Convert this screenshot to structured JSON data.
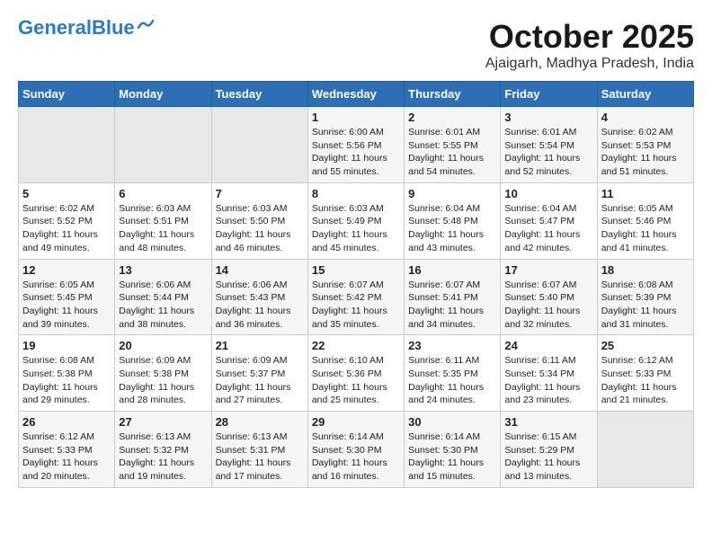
{
  "header": {
    "logo_general": "General",
    "logo_blue": "Blue",
    "month_title": "October 2025",
    "location": "Ajaigarh, Madhya Pradesh, India"
  },
  "weekdays": [
    "Sunday",
    "Monday",
    "Tuesday",
    "Wednesday",
    "Thursday",
    "Friday",
    "Saturday"
  ],
  "weeks": [
    [
      {
        "day": "",
        "empty": true
      },
      {
        "day": "",
        "empty": true
      },
      {
        "day": "",
        "empty": true
      },
      {
        "day": "1",
        "sunrise": "Sunrise: 6:00 AM",
        "sunset": "Sunset: 5:56 PM",
        "daylight": "Daylight: 11 hours and 55 minutes."
      },
      {
        "day": "2",
        "sunrise": "Sunrise: 6:01 AM",
        "sunset": "Sunset: 5:55 PM",
        "daylight": "Daylight: 11 hours and 54 minutes."
      },
      {
        "day": "3",
        "sunrise": "Sunrise: 6:01 AM",
        "sunset": "Sunset: 5:54 PM",
        "daylight": "Daylight: 11 hours and 52 minutes."
      },
      {
        "day": "4",
        "sunrise": "Sunrise: 6:02 AM",
        "sunset": "Sunset: 5:53 PM",
        "daylight": "Daylight: 11 hours and 51 minutes."
      }
    ],
    [
      {
        "day": "5",
        "sunrise": "Sunrise: 6:02 AM",
        "sunset": "Sunset: 5:52 PM",
        "daylight": "Daylight: 11 hours and 49 minutes."
      },
      {
        "day": "6",
        "sunrise": "Sunrise: 6:03 AM",
        "sunset": "Sunset: 5:51 PM",
        "daylight": "Daylight: 11 hours and 48 minutes."
      },
      {
        "day": "7",
        "sunrise": "Sunrise: 6:03 AM",
        "sunset": "Sunset: 5:50 PM",
        "daylight": "Daylight: 11 hours and 46 minutes."
      },
      {
        "day": "8",
        "sunrise": "Sunrise: 6:03 AM",
        "sunset": "Sunset: 5:49 PM",
        "daylight": "Daylight: 11 hours and 45 minutes."
      },
      {
        "day": "9",
        "sunrise": "Sunrise: 6:04 AM",
        "sunset": "Sunset: 5:48 PM",
        "daylight": "Daylight: 11 hours and 43 minutes."
      },
      {
        "day": "10",
        "sunrise": "Sunrise: 6:04 AM",
        "sunset": "Sunset: 5:47 PM",
        "daylight": "Daylight: 11 hours and 42 minutes."
      },
      {
        "day": "11",
        "sunrise": "Sunrise: 6:05 AM",
        "sunset": "Sunset: 5:46 PM",
        "daylight": "Daylight: 11 hours and 41 minutes."
      }
    ],
    [
      {
        "day": "12",
        "sunrise": "Sunrise: 6:05 AM",
        "sunset": "Sunset: 5:45 PM",
        "daylight": "Daylight: 11 hours and 39 minutes."
      },
      {
        "day": "13",
        "sunrise": "Sunrise: 6:06 AM",
        "sunset": "Sunset: 5:44 PM",
        "daylight": "Daylight: 11 hours and 38 minutes."
      },
      {
        "day": "14",
        "sunrise": "Sunrise: 6:06 AM",
        "sunset": "Sunset: 5:43 PM",
        "daylight": "Daylight: 11 hours and 36 minutes."
      },
      {
        "day": "15",
        "sunrise": "Sunrise: 6:07 AM",
        "sunset": "Sunset: 5:42 PM",
        "daylight": "Daylight: 11 hours and 35 minutes."
      },
      {
        "day": "16",
        "sunrise": "Sunrise: 6:07 AM",
        "sunset": "Sunset: 5:41 PM",
        "daylight": "Daylight: 11 hours and 34 minutes."
      },
      {
        "day": "17",
        "sunrise": "Sunrise: 6:07 AM",
        "sunset": "Sunset: 5:40 PM",
        "daylight": "Daylight: 11 hours and 32 minutes."
      },
      {
        "day": "18",
        "sunrise": "Sunrise: 6:08 AM",
        "sunset": "Sunset: 5:39 PM",
        "daylight": "Daylight: 11 hours and 31 minutes."
      }
    ],
    [
      {
        "day": "19",
        "sunrise": "Sunrise: 6:08 AM",
        "sunset": "Sunset: 5:38 PM",
        "daylight": "Daylight: 11 hours and 29 minutes."
      },
      {
        "day": "20",
        "sunrise": "Sunrise: 6:09 AM",
        "sunset": "Sunset: 5:38 PM",
        "daylight": "Daylight: 11 hours and 28 minutes."
      },
      {
        "day": "21",
        "sunrise": "Sunrise: 6:09 AM",
        "sunset": "Sunset: 5:37 PM",
        "daylight": "Daylight: 11 hours and 27 minutes."
      },
      {
        "day": "22",
        "sunrise": "Sunrise: 6:10 AM",
        "sunset": "Sunset: 5:36 PM",
        "daylight": "Daylight: 11 hours and 25 minutes."
      },
      {
        "day": "23",
        "sunrise": "Sunrise: 6:11 AM",
        "sunset": "Sunset: 5:35 PM",
        "daylight": "Daylight: 11 hours and 24 minutes."
      },
      {
        "day": "24",
        "sunrise": "Sunrise: 6:11 AM",
        "sunset": "Sunset: 5:34 PM",
        "daylight": "Daylight: 11 hours and 23 minutes."
      },
      {
        "day": "25",
        "sunrise": "Sunrise: 6:12 AM",
        "sunset": "Sunset: 5:33 PM",
        "daylight": "Daylight: 11 hours and 21 minutes."
      }
    ],
    [
      {
        "day": "26",
        "sunrise": "Sunrise: 6:12 AM",
        "sunset": "Sunset: 5:33 PM",
        "daylight": "Daylight: 11 hours and 20 minutes."
      },
      {
        "day": "27",
        "sunrise": "Sunrise: 6:13 AM",
        "sunset": "Sunset: 5:32 PM",
        "daylight": "Daylight: 11 hours and 19 minutes."
      },
      {
        "day": "28",
        "sunrise": "Sunrise: 6:13 AM",
        "sunset": "Sunset: 5:31 PM",
        "daylight": "Daylight: 11 hours and 17 minutes."
      },
      {
        "day": "29",
        "sunrise": "Sunrise: 6:14 AM",
        "sunset": "Sunset: 5:30 PM",
        "daylight": "Daylight: 11 hours and 16 minutes."
      },
      {
        "day": "30",
        "sunrise": "Sunrise: 6:14 AM",
        "sunset": "Sunset: 5:30 PM",
        "daylight": "Daylight: 11 hours and 15 minutes."
      },
      {
        "day": "31",
        "sunrise": "Sunrise: 6:15 AM",
        "sunset": "Sunset: 5:29 PM",
        "daylight": "Daylight: 11 hours and 13 minutes."
      },
      {
        "day": "",
        "empty": true
      }
    ]
  ]
}
